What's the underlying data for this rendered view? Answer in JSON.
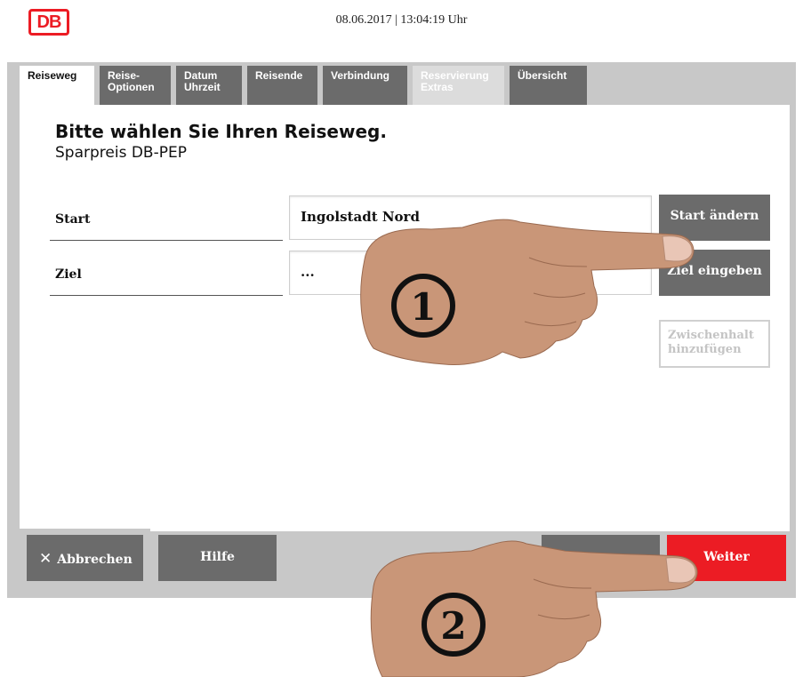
{
  "header": {
    "datetime": "08.06.2017 | 13:04:19 Uhr",
    "logo": "DB"
  },
  "tabs": [
    {
      "line1": "Reiseweg",
      "line2": ""
    },
    {
      "line1": "Reise-",
      "line2": "Optionen"
    },
    {
      "line1": "Datum",
      "line2": "Uhrzeit"
    },
    {
      "line1": "Reisende",
      "line2": ""
    },
    {
      "line1": "Verbindung",
      "line2": ""
    },
    {
      "line1": "Reservierung",
      "line2": "Extras"
    },
    {
      "line1": "Übersicht",
      "line2": ""
    }
  ],
  "main": {
    "heading": "Bitte wählen Sie Ihren Reiseweg.",
    "subheading": "Sparpreis DB-PEP",
    "start": {
      "label": "Start",
      "value": "Ingolstadt Nord",
      "button": "Start ändern"
    },
    "ziel": {
      "label": "Ziel",
      "value": "...",
      "button": "Ziel eingeben"
    },
    "zwischenhalt": {
      "line1": "Zwischenhalt",
      "line2": "hinzufügen"
    }
  },
  "footer": {
    "cancel": "Abbrechen",
    "help": "Hilfe",
    "next": "Weiter"
  },
  "annotations": {
    "step1": "1",
    "step2": "2"
  },
  "colors": {
    "accent": "#ec1c24",
    "button": "#6b6b6b",
    "frame": "#c8c8c8",
    "disabled": "#dcdcdc"
  }
}
